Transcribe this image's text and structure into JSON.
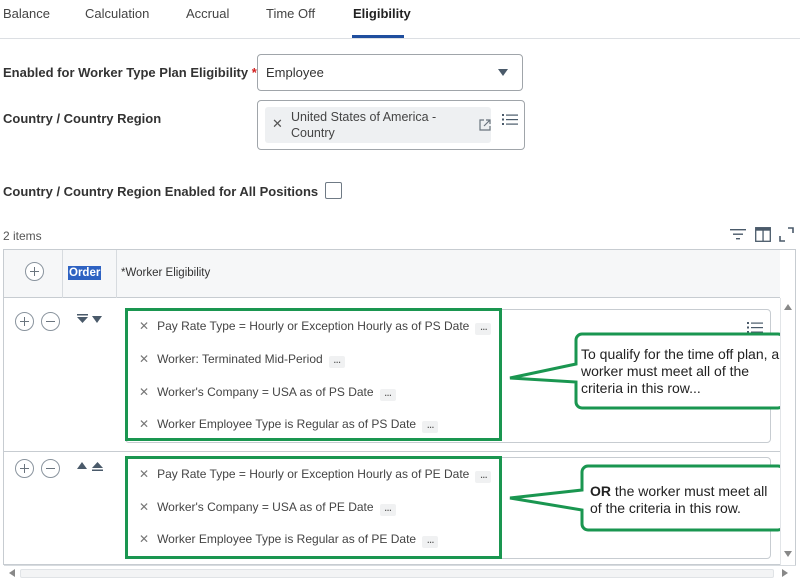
{
  "tabs": [
    {
      "label": "Balance"
    },
    {
      "label": "Calculation"
    },
    {
      "label": "Accrual"
    },
    {
      "label": "Time Off"
    },
    {
      "label": "Eligibility",
      "active": true
    }
  ],
  "form": {
    "worker_type_label": "Enabled for Worker Type Plan Eligibility",
    "required_marker": "*",
    "worker_type_value": "Employee",
    "country_label": "Country / Country Region",
    "country_value": "United States of America - Country",
    "all_positions_label": "Country / Country Region Enabled for All Positions",
    "all_positions_checked": false
  },
  "table": {
    "items_count": "2 items",
    "col_order": "Order",
    "col_eligibility": "*Worker Eligibility",
    "rows": [
      {
        "criteria": [
          "Pay Rate Type = Hourly or Exception Hourly as of PS Date",
          "Worker: Terminated Mid-Period",
          "Worker's Company = USA as of PS Date",
          "Worker Employee Type is Regular as of PS Date"
        ]
      },
      {
        "criteria": [
          "Pay Rate Type = Hourly or Exception Hourly as of PE Date",
          "Worker's Company = USA as of PE Date",
          "Worker Employee Type is Regular as of PE Date"
        ]
      }
    ]
  },
  "callouts": {
    "first": "To qualify for the time off plan, a worker must meet all of the criteria in this row...",
    "second_bold": "OR",
    "second_rest": " the worker must meet all of the criteria in this row."
  },
  "colors": {
    "accent": "#1f4e9e",
    "annotation_green": "#1a9650",
    "required": "#d21f1f"
  },
  "icons": [
    "remove-icon",
    "open-external-icon",
    "list-icon",
    "filter-icon",
    "columns-icon",
    "expand-icon",
    "add-row-icon",
    "remove-row-icon",
    "move-down-icon",
    "move-up-icon",
    "more-icon"
  ]
}
